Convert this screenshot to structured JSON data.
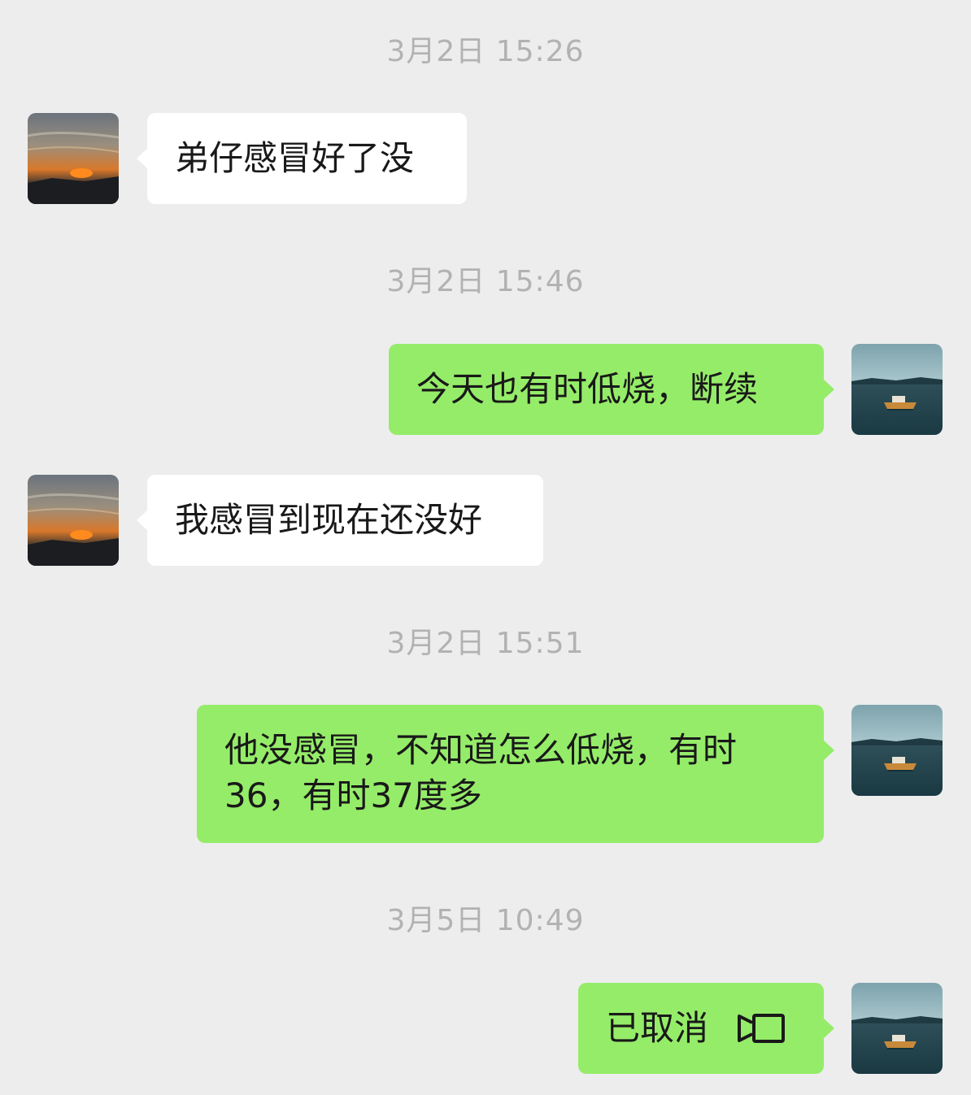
{
  "conversation": {
    "timestamps": [
      "3月2日 15:26",
      "3月2日 15:46",
      "3月2日 15:51",
      "3月5日 10:49"
    ],
    "messages": [
      {
        "sender": "other",
        "text": "弟仔感冒好了没"
      },
      {
        "sender": "self",
        "text": "今天也有时低烧，断续"
      },
      {
        "sender": "other",
        "text": "我感冒到现在还没好"
      },
      {
        "sender": "self",
        "text": "他没感冒，不知道怎么低烧，有时36，有时37度多"
      },
      {
        "sender": "self",
        "text": "已取消",
        "icon": "video-call-icon"
      }
    ]
  },
  "avatars": {
    "other": {
      "icon": "sunset-avatar",
      "description_colors": [
        "#5b6470",
        "#e07a2a",
        "#1c1f24"
      ]
    },
    "self": {
      "icon": "boat-on-lake-avatar",
      "description_colors": [
        "#2f5f6c",
        "#8fb7c0",
        "#1a3a44"
      ]
    }
  },
  "colors": {
    "background": "#ededed",
    "incoming_bubble": "#ffffff",
    "outgoing_bubble": "#95ec69",
    "timestamp": "#b2b2b2",
    "text": "#191919"
  }
}
